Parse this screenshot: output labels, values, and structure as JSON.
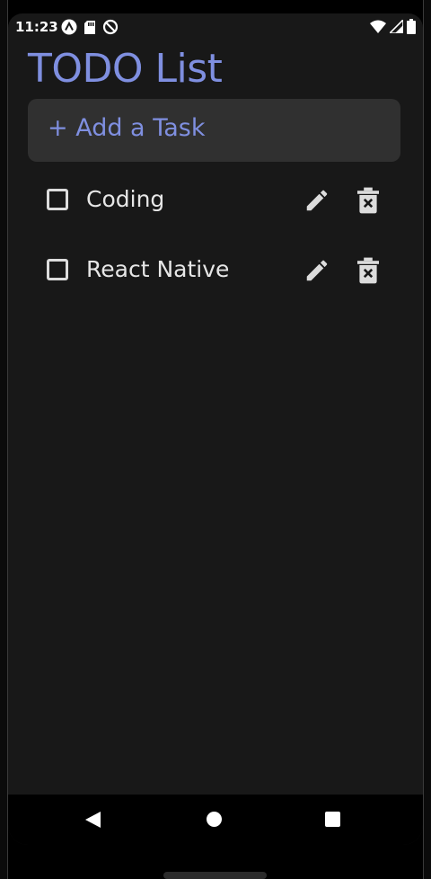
{
  "status_bar": {
    "time": "11:23",
    "left_icons": [
      "app-a-icon",
      "sd-card-icon",
      "do-not-disturb-icon"
    ],
    "right_icons": [
      "wifi-icon",
      "cell-signal-icon",
      "battery-icon"
    ]
  },
  "header": {
    "title": "TODO List"
  },
  "add_task": {
    "label": "+ Add a Task"
  },
  "tasks": [
    {
      "label": "Coding",
      "checked": false
    },
    {
      "label": "React Native",
      "checked": false
    }
  ],
  "colors": {
    "accent": "#7f8fe0",
    "background": "#181818",
    "input_background": "#303030",
    "text": "#e6e6e6"
  }
}
